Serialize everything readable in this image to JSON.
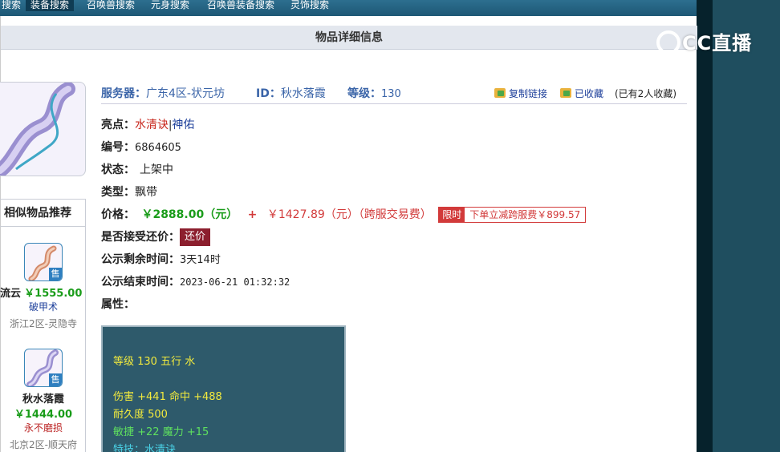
{
  "topnav": {
    "tabs": [
      {
        "label": "搜索",
        "active": false
      },
      {
        "label": "装备搜索",
        "active": true
      },
      {
        "label": "召唤兽搜索",
        "active": false
      },
      {
        "label": "元身搜索",
        "active": false
      },
      {
        "label": "召唤兽装备搜索",
        "active": false
      },
      {
        "label": "灵饰搜索",
        "active": false
      }
    ]
  },
  "title": "物品详细信息",
  "logo": {
    "text": "CC直播"
  },
  "similar": {
    "header": "相似物品推荐",
    "items": [
      {
        "name": "流云",
        "price": "￥1555.00",
        "attr": "破甲术",
        "server": "浙江2区-灵隐寺",
        "badge": "售"
      },
      {
        "name": "秋水落霞",
        "price": "￥1444.00",
        "attr": "永不磨损",
        "server": "北京2区-顺天府",
        "badge": "售"
      }
    ]
  },
  "header": {
    "server_label": "服务器：",
    "server_value": "广东4区-状元坊",
    "id_label": "ID：",
    "id_value": "秋水落霞",
    "level_label": "等级：",
    "level_value": "130",
    "copy_link": "复制链接",
    "favorited": "已收藏",
    "fav_count": "(已有2人收藏)"
  },
  "details": {
    "highlight_label": "亮点：",
    "highlight_a": "水清诀",
    "highlight_sep": "|",
    "highlight_b": "神佑",
    "number_label": "编号：",
    "number_value": "6864605",
    "status_label": "状态：",
    "status_value": "上架中",
    "type_label": "类型：",
    "type_value": "飘带",
    "price_label": "价格：",
    "price_main": "￥2888.00（元）",
    "price_plus": "+",
    "price_fee": "￥1427.89（元）（跨服交易费）",
    "promo_tag": "限时",
    "promo_text": "下单立减跨服费￥899.57",
    "counter_label": "是否接受还价：",
    "counter_button": "还价",
    "remaining_label": "公示剩余时间：",
    "remaining_value": "3天14时",
    "end_label": "公示结束时间：",
    "end_value": "2023-06-21 01:32:32",
    "attr_label": "属性："
  },
  "attributes": {
    "line1": "等级 130 五行 水",
    "line2": "伤害 +441 命中 +488",
    "line3": "耐久度 500",
    "line4": "敏捷 +22 魔力 +15",
    "line5": "特技：水清诀"
  },
  "colors": {
    "accent_blue": "#3a64a8",
    "price_green": "#1a9c1a",
    "price_red": "#d23a3a",
    "attr_yellow": "#f2ea3d",
    "attr_green": "#5fe05f",
    "attr_cyan": "#4ad2e6"
  }
}
